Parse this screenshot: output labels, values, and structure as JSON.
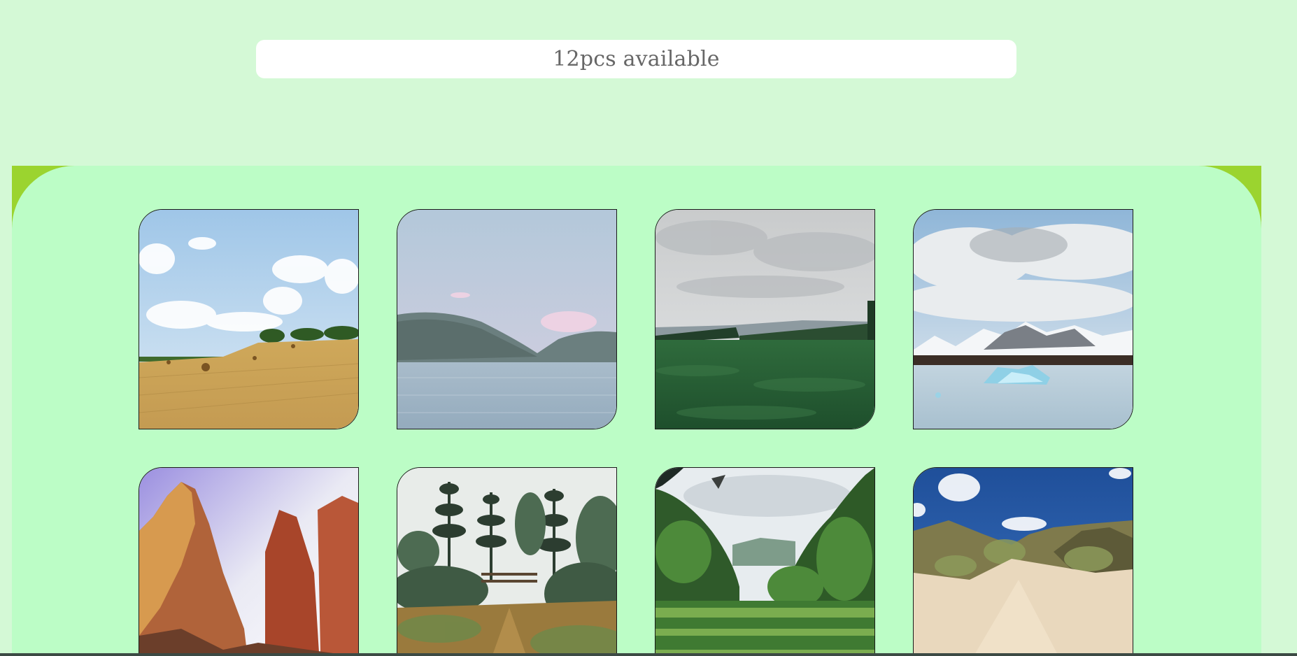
{
  "availability": {
    "text": "12pcs available"
  },
  "gallery": {
    "tiles": [
      {
        "scene": "wheat-field-hay-bales",
        "icon": "wheat-field-photo"
      },
      {
        "scene": "mountain-lake",
        "icon": "mountain-lake-photo"
      },
      {
        "scene": "green-valley-cloudy-sky",
        "icon": "green-valley-photo"
      },
      {
        "scene": "glacier-lagoon-icebergs",
        "icon": "glacier-lagoon-photo"
      },
      {
        "scene": "red-rock-canyon",
        "icon": "red-rock-canyon-photo"
      },
      {
        "scene": "garden-topiary-trees",
        "icon": "garden-trees-photo"
      },
      {
        "scene": "jungle-valley",
        "icon": "jungle-valley-photo"
      },
      {
        "scene": "sand-dunes-blue-sky",
        "icon": "sand-dunes-photo"
      }
    ]
  },
  "colors": {
    "page_background": "#d4f9d6",
    "panel_background": "#bcfdc6",
    "panel_corner_accent": "#9bd42f",
    "bar_background": "#ffffff",
    "bar_text": "#666666"
  }
}
